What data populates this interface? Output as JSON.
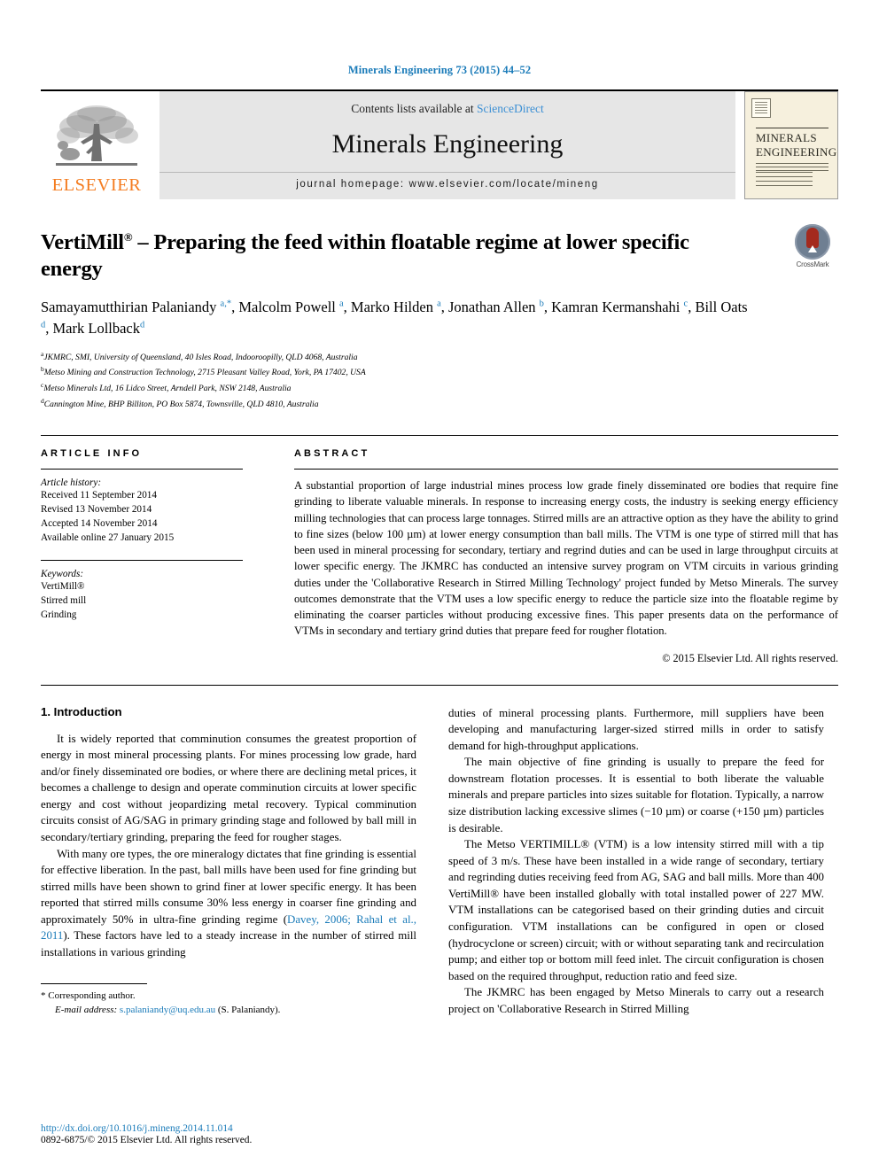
{
  "running_head": "Minerals Engineering 73 (2015) 44–52",
  "masthead": {
    "contents_prefix": "Contents lists available at ",
    "sciencedirect": "ScienceDirect",
    "journal_name": "Minerals Engineering",
    "homepage": "journal homepage: www.elsevier.com/locate/mineng",
    "publisher_wordmark": "ELSEVIER",
    "cover_title_line1": "MINERALS",
    "cover_title_line2": "ENGINEERING"
  },
  "crossmark": {
    "label": "CrossMark"
  },
  "title": {
    "main": "VertiMill",
    "sup": "®",
    "rest": " – Preparing the feed within floatable regime at lower specific energy"
  },
  "authors_html": "Samayamutthirian Palaniandy <sup>a,*</sup>, Malcolm Powell <sup>a</sup>, Marko Hilden <sup>a</sup>, Jonathan Allen <sup>b</sup>, Kamran Kermanshahi <sup>c</sup>, Bill Oats <sup>d</sup>, Mark Lollback<sup>d</sup>",
  "affiliations": [
    {
      "marker": "a",
      "text": "JKMRC, SMI, University of Queensland, 40 Isles Road, Indooroopilly, QLD 4068, Australia"
    },
    {
      "marker": "b",
      "text": "Metso Mining and Construction Technology, 2715 Pleasant Valley Road, York, PA 17402, USA"
    },
    {
      "marker": "c",
      "text": "Metso Minerals Ltd, 16 Lidco Street, Arndell Park, NSW 2148, Australia"
    },
    {
      "marker": "d",
      "text": "Cannington Mine, BHP Billiton, PO Box 5874, Townsville, QLD 4810, Australia"
    }
  ],
  "article_info": {
    "heading": "ARTICLE INFO",
    "history_label": "Article history:",
    "history": [
      "Received 11 September 2014",
      "Revised 13 November 2014",
      "Accepted 14 November 2014",
      "Available online 27 January 2015"
    ],
    "keywords_label": "Keywords:",
    "keywords": [
      "VertiMill®",
      "Stirred mill",
      "Grinding"
    ]
  },
  "abstract": {
    "heading": "ABSTRACT",
    "text": "A substantial proportion of large industrial mines process low grade finely disseminated ore bodies that require fine grinding to liberate valuable minerals. In response to increasing energy costs, the industry is seeking energy efficiency milling technologies that can process large tonnages. Stirred mills are an attractive option as they have the ability to grind to fine sizes (below 100 µm) at lower energy consumption than ball mills. The VTM is one type of stirred mill that has been used in mineral processing for secondary, tertiary and regrind duties and can be used in large throughput circuits at lower specific energy. The JKMRC has conducted an intensive survey program on VTM circuits in various grinding duties under the 'Collaborative Research in Stirred Milling Technology' project funded by Metso Minerals. The survey outcomes demonstrate that the VTM uses a low specific energy to reduce the particle size into the floatable regime by eliminating the coarser particles without producing excessive fines. This paper presents data on the performance of VTMs in secondary and tertiary grind duties that prepare feed for rougher flotation.",
    "copyright": "© 2015 Elsevier Ltd. All rights reserved."
  },
  "body": {
    "section_heading": "1. Introduction",
    "left_p1": "It is widely reported that comminution consumes the greatest proportion of energy in most mineral processing plants. For mines processing low grade, hard and/or finely disseminated ore bodies, or where there are declining metal prices, it becomes a challenge to design and operate comminution circuits at lower specific energy and cost without jeopardizing metal recovery. Typical comminution circuits consist of AG/SAG in primary grinding stage and followed by ball mill in secondary/tertiary grinding, preparing the feed for rougher stages.",
    "left_p2_pre": "With many ore types, the ore mineralogy dictates that fine grinding is essential for effective liberation. In the past, ball mills have been used for fine grinding but stirred mills have been shown to grind finer at lower specific energy. It has been reported that stirred mills consume 30% less energy in coarser fine grinding and approximately 50% in ultra-fine grinding regime (",
    "left_p2_cite": "Davey, 2006; Rahal et al., 2011",
    "left_p2_post": "). These factors have led to a steady increase in the number of stirred mill installations in various grinding",
    "right_p1": "duties of mineral processing plants. Furthermore, mill suppliers have been developing and manufacturing larger-sized stirred mills in order to satisfy demand for high-throughput applications.",
    "right_p2": "The main objective of fine grinding is usually to prepare the feed for downstream flotation processes. It is essential to both liberate the valuable minerals and prepare particles into sizes suitable for flotation. Typically, a narrow size distribution lacking excessive slimes (−10 µm) or coarse (+150 µm) particles is desirable.",
    "right_p3": "The Metso VERTIMILL® (VTM) is a low intensity stirred mill with a tip speed of 3 m/s. These have been installed in a wide range of secondary, tertiary and regrinding duties receiving feed from AG, SAG and ball mills. More than 400 VertiMill® have been installed globally with total installed power of 227 MW. VTM installations can be categorised based on their grinding duties and circuit configuration. VTM installations can be configured in open or closed (hydrocyclone or screen) circuit; with or without separating tank and recirculation pump; and either top or bottom mill feed inlet. The circuit configuration is chosen based on the required throughput, reduction ratio and feed size.",
    "right_p4": "The JKMRC has been engaged by Metso Minerals to carry out a research project on 'Collaborative Research in Stirred Milling"
  },
  "footnote": {
    "corresponding": "* Corresponding author.",
    "email_label": "E-mail address:",
    "email": "s.palaniandy@uq.edu.au",
    "email_suffix": "(S. Palaniandy)."
  },
  "doi": {
    "url": "http://dx.doi.org/10.1016/j.mineng.2014.11.014",
    "issn_line": "0892-6875/© 2015 Elsevier Ltd. All rights reserved."
  },
  "colors": {
    "link": "#1a7bb9",
    "elsevier_orange": "#f47c20",
    "masthead_bg": "#e6e6e6"
  }
}
